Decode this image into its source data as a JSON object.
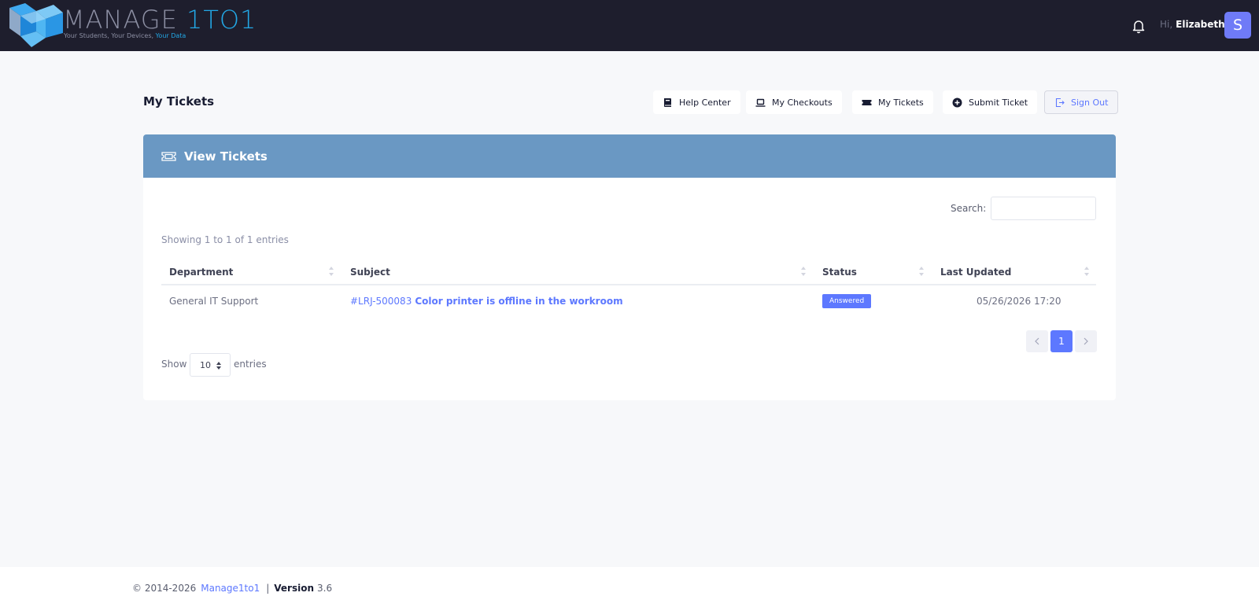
{
  "brand": {
    "name_part1": "MANAGE",
    "name_part2": "1TO1",
    "tagline_part1": "Your Students, Your Devices,",
    "tagline_part2": "Your Data"
  },
  "user": {
    "greeting": "Hi,",
    "name": "Elizabeth",
    "avatar_letter": "S"
  },
  "page": {
    "title": "My Tickets"
  },
  "toolbar": {
    "help_center": "Help Center",
    "my_checkouts": "My Checkouts",
    "my_tickets": "My Tickets",
    "submit_ticket": "Submit Ticket",
    "sign_out": "Sign Out"
  },
  "card": {
    "title": "View Tickets",
    "search_label": "Search:",
    "search_value": "",
    "info": "Showing 1 to 1 of 1 entries",
    "columns": [
      "Department",
      "Subject",
      "Status",
      "Last Updated"
    ],
    "rows": [
      {
        "department": "General IT Support",
        "ticket_id": "#LRJ-500083",
        "subject": "Color printer is offline in the workroom",
        "status": "Answered",
        "last_updated": "05/26/2026 17:20"
      }
    ],
    "pagination": {
      "current_page": "1"
    },
    "length": {
      "show_label": "Show",
      "selected": "10",
      "entries_label": "entries"
    }
  },
  "footer": {
    "copyright": "© 2014-2026",
    "link": "Manage1to1",
    "separator": "|",
    "version_label": "Version",
    "version": "3.6"
  },
  "colors": {
    "topbar": "#1e1e2d",
    "card_header": "#6a98c3",
    "accent": "#5d78ff",
    "avatar": "#6f7bf7"
  }
}
